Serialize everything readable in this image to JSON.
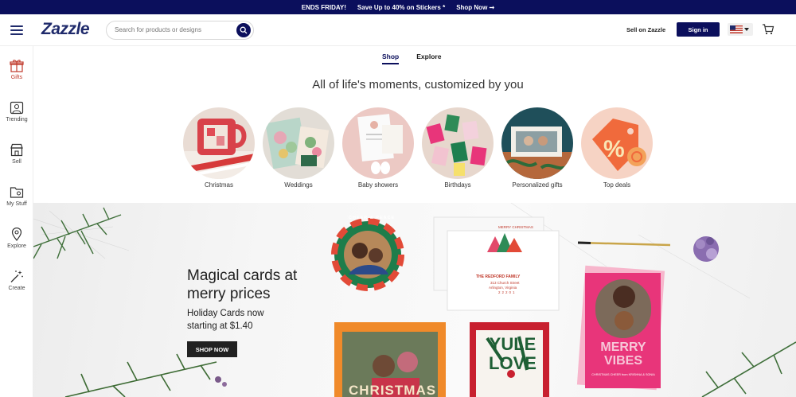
{
  "promo": {
    "ends": "ENDS FRIDAY!",
    "offer": "Save Up to 40% on Stickers *",
    "cta": "Shop Now ➞"
  },
  "header": {
    "logo": "Zazzle",
    "search_placeholder": "Search for products or designs",
    "sell": "Sell on Zazzle",
    "signin": "Sign in"
  },
  "sidebar": {
    "items": [
      {
        "label": "Gifts",
        "icon": "gift-icon"
      },
      {
        "label": "Trending",
        "icon": "trending-icon"
      },
      {
        "label": "Sell",
        "icon": "store-icon"
      },
      {
        "label": "My Stuff",
        "icon": "folder-icon"
      },
      {
        "label": "Explore",
        "icon": "map-pin-icon"
      },
      {
        "label": "Create",
        "icon": "magic-wand-icon"
      }
    ]
  },
  "tabs": {
    "shop": "Shop",
    "explore": "Explore"
  },
  "headline": "All of life's moments, customized by you",
  "categories": [
    {
      "label": "Christmas"
    },
    {
      "label": "Weddings"
    },
    {
      "label": "Baby showers"
    },
    {
      "label": "Birthdays"
    },
    {
      "label": "Personalized gifts"
    },
    {
      "label": "Top deals"
    }
  ],
  "hero": {
    "title": "Magical cards at merry prices",
    "subtitle": "Holiday Cards now starting at $1.40",
    "button": "SHOP NOW",
    "card_merry": "MERRY VIBES",
    "card_yule": "YULE LOVE",
    "card_christmas": "CHRISTMAS",
    "round_card": "CHEER & PEACE",
    "envelope_family": "THE REDFORD FAMILY",
    "envelope_addr1": "313 Church Street",
    "envelope_addr2": "Arlington, Virginia",
    "envelope_zip": "22201",
    "envelope_top": "MERRY CHRISTMAS",
    "merry_footer": "CHRISTMAS CHEER from KRISHNA & SONIA"
  },
  "colors": {
    "brand": "#0b0f5c",
    "accent": "#c0392b",
    "pink": "#e8357a"
  }
}
